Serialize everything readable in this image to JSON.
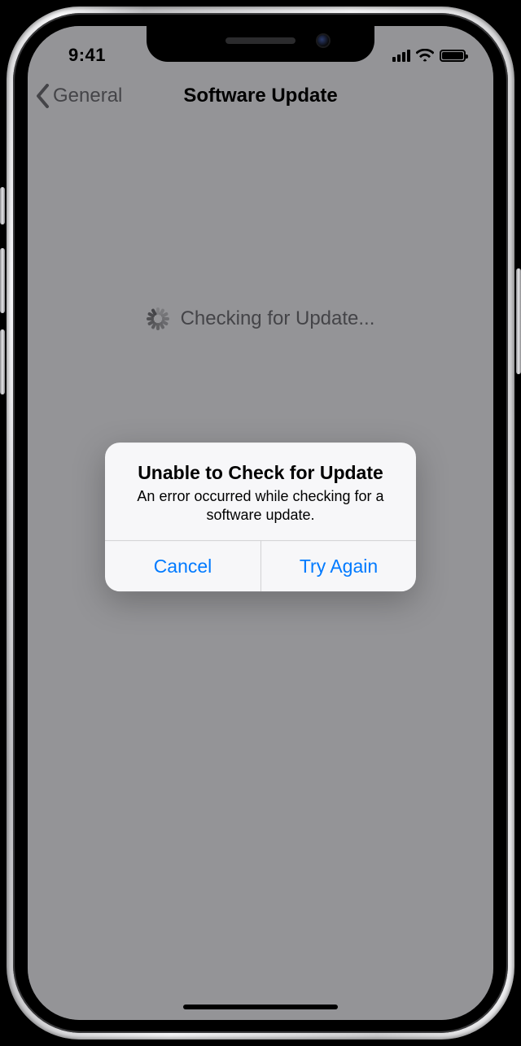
{
  "statusbar": {
    "time": "9:41"
  },
  "nav": {
    "back_label": "General",
    "title": "Software Update"
  },
  "body": {
    "checking_label": "Checking for Update..."
  },
  "alert": {
    "title": "Unable to Check for Update",
    "message": "An error occurred while checking for a software update.",
    "cancel_label": "Cancel",
    "retry_label": "Try Again"
  },
  "icons": {
    "spinner": "spinner-icon",
    "back": "chevron-left-icon",
    "cell": "cellular-signal-icon",
    "wifi": "wifi-icon",
    "battery": "battery-icon"
  }
}
